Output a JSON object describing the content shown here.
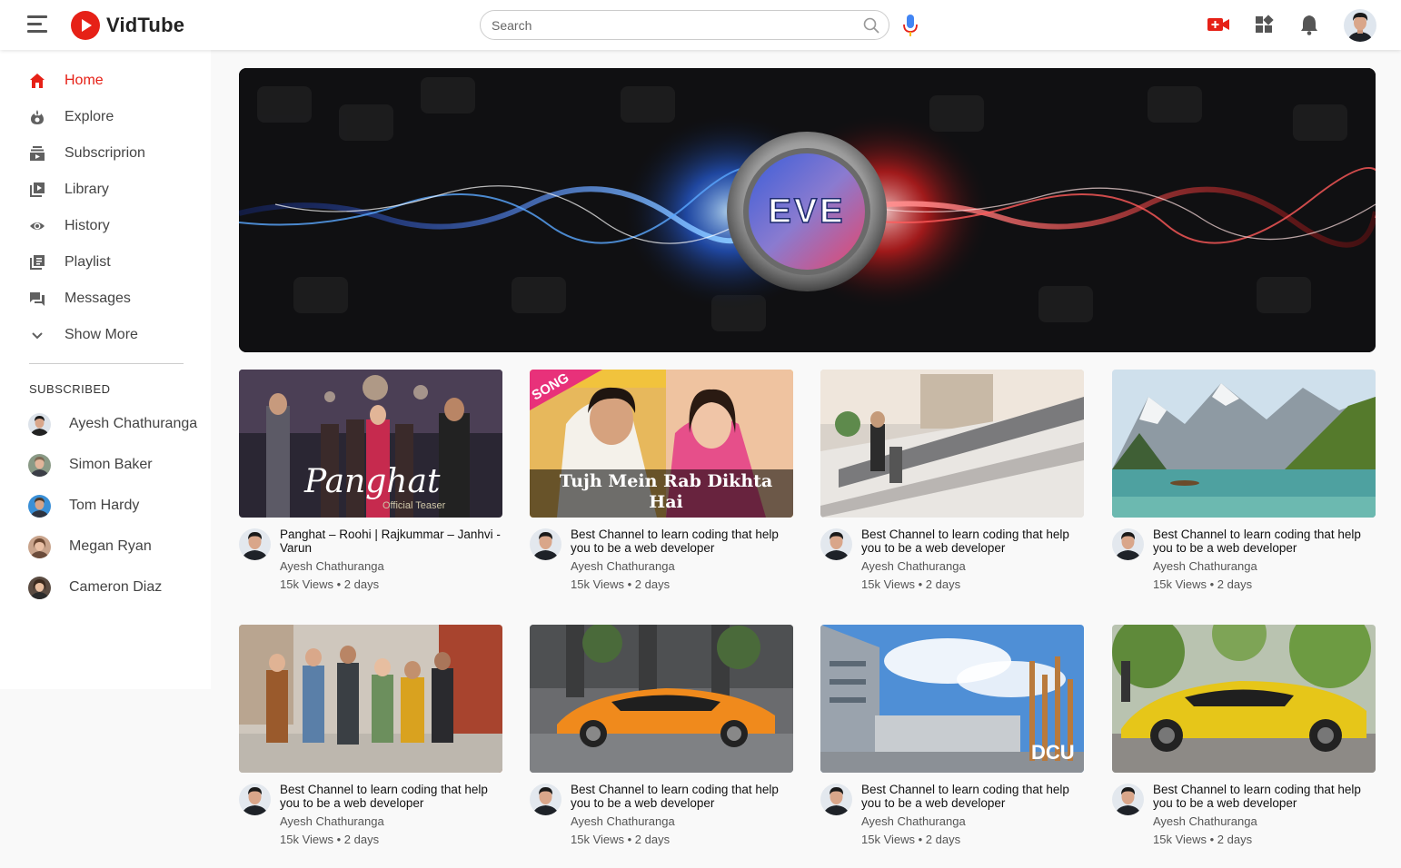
{
  "app": {
    "name": "VidTube"
  },
  "search": {
    "placeholder": "Search"
  },
  "sidebar": {
    "items": [
      {
        "label": "Home",
        "icon": "home-icon",
        "active": true
      },
      {
        "label": "Explore",
        "icon": "fire-icon"
      },
      {
        "label": "Subscriprion",
        "icon": "subscriptions-icon"
      },
      {
        "label": "Library",
        "icon": "library-icon"
      },
      {
        "label": "History",
        "icon": "history-icon"
      },
      {
        "label": "Playlist",
        "icon": "playlist-icon"
      },
      {
        "label": "Messages",
        "icon": "messages-icon"
      },
      {
        "label": "Show More",
        "icon": "chevron-down-icon"
      }
    ],
    "subscribed_title": "SUBSCRIBED",
    "subscriptions": [
      {
        "name": "Ayesh Chathuranga"
      },
      {
        "name": "Simon Baker"
      },
      {
        "name": "Tom Hardy"
      },
      {
        "name": "Megan Ryan"
      },
      {
        "name": "Cameron Diaz"
      }
    ]
  },
  "banner": {
    "logo_text": "EVE"
  },
  "videos": [
    {
      "title": "Panghat – Roohi | Rajkummar – Janhvi - Varun",
      "channel": "Ayesh Chathuranga",
      "meta": "15k Views • 2 days",
      "thumb_text": "Panghat",
      "thumb_sub": "Official Teaser"
    },
    {
      "title": "Best Channel to learn coding that help you to be a web developer",
      "channel": "Ayesh Chathuranga",
      "meta": "15k Views • 2 days",
      "thumb_text": "Tujh Mein Rab Dikhta Hai",
      "thumb_sub": "SONG"
    },
    {
      "title": "Best Channel to learn coding that help you to be a web developer",
      "channel": "Ayesh Chathuranga",
      "meta": "15k Views • 2 days"
    },
    {
      "title": "Best Channel to learn coding that help you to be a web developer",
      "channel": "Ayesh Chathuranga",
      "meta": "15k Views • 2 days"
    },
    {
      "title": "Best Channel to learn coding that help you to be a web developer",
      "channel": "Ayesh Chathuranga",
      "meta": "15k Views • 2 days"
    },
    {
      "title": "Best Channel to learn coding that help you to be a web developer",
      "channel": "Ayesh Chathuranga",
      "meta": "15k Views • 2 days"
    },
    {
      "title": "Best Channel to learn coding that help you to be a web developer",
      "channel": "Ayesh Chathuranga",
      "meta": "15k Views • 2 days",
      "thumb_text": "DCU"
    },
    {
      "title": "Best Channel to learn coding that help you to be a web developer",
      "channel": "Ayesh Chathuranga",
      "meta": "15k Views • 2 days"
    }
  ],
  "colors": {
    "brand": "#e62117",
    "text": "#111111",
    "muted": "#555555"
  }
}
